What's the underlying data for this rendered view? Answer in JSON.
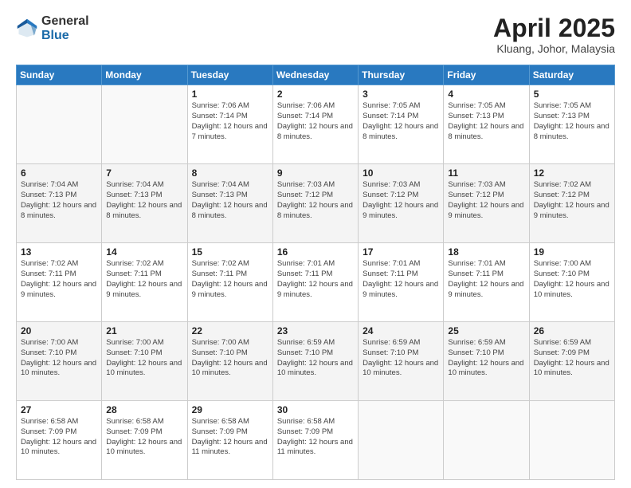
{
  "header": {
    "logo_general": "General",
    "logo_blue": "Blue",
    "month_title": "April 2025",
    "location": "Kluang, Johor, Malaysia"
  },
  "weekdays": [
    "Sunday",
    "Monday",
    "Tuesday",
    "Wednesday",
    "Thursday",
    "Friday",
    "Saturday"
  ],
  "weeks": [
    [
      {
        "day": "",
        "info": ""
      },
      {
        "day": "",
        "info": ""
      },
      {
        "day": "1",
        "info": "Sunrise: 7:06 AM\nSunset: 7:14 PM\nDaylight: 12 hours\nand 7 minutes."
      },
      {
        "day": "2",
        "info": "Sunrise: 7:06 AM\nSunset: 7:14 PM\nDaylight: 12 hours\nand 8 minutes."
      },
      {
        "day": "3",
        "info": "Sunrise: 7:05 AM\nSunset: 7:14 PM\nDaylight: 12 hours\nand 8 minutes."
      },
      {
        "day": "4",
        "info": "Sunrise: 7:05 AM\nSunset: 7:13 PM\nDaylight: 12 hours\nand 8 minutes."
      },
      {
        "day": "5",
        "info": "Sunrise: 7:05 AM\nSunset: 7:13 PM\nDaylight: 12 hours\nand 8 minutes."
      }
    ],
    [
      {
        "day": "6",
        "info": "Sunrise: 7:04 AM\nSunset: 7:13 PM\nDaylight: 12 hours\nand 8 minutes."
      },
      {
        "day": "7",
        "info": "Sunrise: 7:04 AM\nSunset: 7:13 PM\nDaylight: 12 hours\nand 8 minutes."
      },
      {
        "day": "8",
        "info": "Sunrise: 7:04 AM\nSunset: 7:13 PM\nDaylight: 12 hours\nand 8 minutes."
      },
      {
        "day": "9",
        "info": "Sunrise: 7:03 AM\nSunset: 7:12 PM\nDaylight: 12 hours\nand 8 minutes."
      },
      {
        "day": "10",
        "info": "Sunrise: 7:03 AM\nSunset: 7:12 PM\nDaylight: 12 hours\nand 9 minutes."
      },
      {
        "day": "11",
        "info": "Sunrise: 7:03 AM\nSunset: 7:12 PM\nDaylight: 12 hours\nand 9 minutes."
      },
      {
        "day": "12",
        "info": "Sunrise: 7:02 AM\nSunset: 7:12 PM\nDaylight: 12 hours\nand 9 minutes."
      }
    ],
    [
      {
        "day": "13",
        "info": "Sunrise: 7:02 AM\nSunset: 7:11 PM\nDaylight: 12 hours\nand 9 minutes."
      },
      {
        "day": "14",
        "info": "Sunrise: 7:02 AM\nSunset: 7:11 PM\nDaylight: 12 hours\nand 9 minutes."
      },
      {
        "day": "15",
        "info": "Sunrise: 7:02 AM\nSunset: 7:11 PM\nDaylight: 12 hours\nand 9 minutes."
      },
      {
        "day": "16",
        "info": "Sunrise: 7:01 AM\nSunset: 7:11 PM\nDaylight: 12 hours\nand 9 minutes."
      },
      {
        "day": "17",
        "info": "Sunrise: 7:01 AM\nSunset: 7:11 PM\nDaylight: 12 hours\nand 9 minutes."
      },
      {
        "day": "18",
        "info": "Sunrise: 7:01 AM\nSunset: 7:11 PM\nDaylight: 12 hours\nand 9 minutes."
      },
      {
        "day": "19",
        "info": "Sunrise: 7:00 AM\nSunset: 7:10 PM\nDaylight: 12 hours\nand 10 minutes."
      }
    ],
    [
      {
        "day": "20",
        "info": "Sunrise: 7:00 AM\nSunset: 7:10 PM\nDaylight: 12 hours\nand 10 minutes."
      },
      {
        "day": "21",
        "info": "Sunrise: 7:00 AM\nSunset: 7:10 PM\nDaylight: 12 hours\nand 10 minutes."
      },
      {
        "day": "22",
        "info": "Sunrise: 7:00 AM\nSunset: 7:10 PM\nDaylight: 12 hours\nand 10 minutes."
      },
      {
        "day": "23",
        "info": "Sunrise: 6:59 AM\nSunset: 7:10 PM\nDaylight: 12 hours\nand 10 minutes."
      },
      {
        "day": "24",
        "info": "Sunrise: 6:59 AM\nSunset: 7:10 PM\nDaylight: 12 hours\nand 10 minutes."
      },
      {
        "day": "25",
        "info": "Sunrise: 6:59 AM\nSunset: 7:10 PM\nDaylight: 12 hours\nand 10 minutes."
      },
      {
        "day": "26",
        "info": "Sunrise: 6:59 AM\nSunset: 7:09 PM\nDaylight: 12 hours\nand 10 minutes."
      }
    ],
    [
      {
        "day": "27",
        "info": "Sunrise: 6:58 AM\nSunset: 7:09 PM\nDaylight: 12 hours\nand 10 minutes."
      },
      {
        "day": "28",
        "info": "Sunrise: 6:58 AM\nSunset: 7:09 PM\nDaylight: 12 hours\nand 10 minutes."
      },
      {
        "day": "29",
        "info": "Sunrise: 6:58 AM\nSunset: 7:09 PM\nDaylight: 12 hours\nand 11 minutes."
      },
      {
        "day": "30",
        "info": "Sunrise: 6:58 AM\nSunset: 7:09 PM\nDaylight: 12 hours\nand 11 minutes."
      },
      {
        "day": "",
        "info": ""
      },
      {
        "day": "",
        "info": ""
      },
      {
        "day": "",
        "info": ""
      }
    ]
  ]
}
